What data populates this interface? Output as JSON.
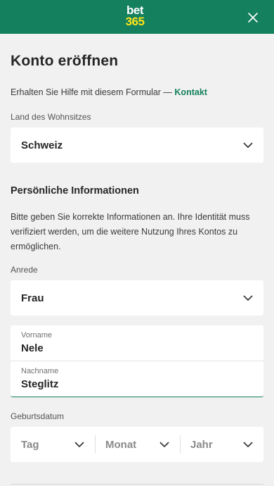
{
  "header": {
    "logo_line1": "bet",
    "logo_line2": "365",
    "brand_color": "#14805e",
    "logo_accent": "#ffe418",
    "close_icon": "close-icon"
  },
  "form": {
    "title": "Konto eröffnen",
    "help_text": "Erhalten Sie Hilfe mit diesem Formular — ",
    "help_link": "Kontakt",
    "country_label": "Land des Wohnsitzes",
    "country_value": "Schweiz",
    "personal_heading": "Persönliche Informationen",
    "personal_text": "Bitte geben Sie korrekte Informationen an. Ihre Identität muss verifiziert werden, um die weitere Nutzung Ihres Kontos zu ermöglichen.",
    "salutation_label": "Anrede",
    "salutation_value": "Frau",
    "firstname_label": "Vorname",
    "firstname_value": "Nele",
    "lastname_label": "Nachname",
    "lastname_value": "Steglitz",
    "dob_label": "Geburtsdatum",
    "dob_day": "Tag",
    "dob_month": "Monat",
    "dob_year": "Jahr"
  }
}
